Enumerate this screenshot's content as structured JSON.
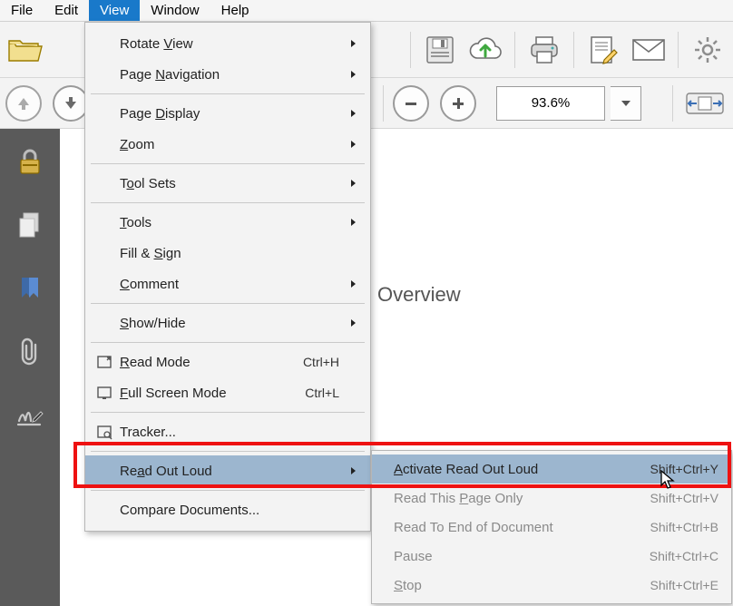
{
  "menubar": {
    "items": [
      "File",
      "Edit",
      "View",
      "Window",
      "Help"
    ],
    "selected": 2
  },
  "toolbar": {
    "open_label": "O"
  },
  "zoom": {
    "value": "93.6%"
  },
  "document": {
    "heading": "Overview"
  },
  "view_menu": {
    "items": [
      {
        "label": "Rotate View",
        "mn": "V",
        "sub": true
      },
      {
        "label": "Page Navigation",
        "mn": "N",
        "sub": true
      },
      {
        "sep": true
      },
      {
        "label": "Page Display",
        "mn": "D",
        "sub": true
      },
      {
        "label": "Zoom",
        "mn": "Z",
        "sub": true
      },
      {
        "sep": true
      },
      {
        "label": "Tool Sets",
        "mn": "o",
        "sub": true
      },
      {
        "sep": true
      },
      {
        "label": "Tools",
        "mn": "T",
        "sub": true
      },
      {
        "label": "Fill & Sign",
        "mn": "S"
      },
      {
        "label": "Comment",
        "mn": "C",
        "sub": true
      },
      {
        "sep": true
      },
      {
        "label": "Show/Hide",
        "mn": "S",
        "sub": true
      },
      {
        "sep": true
      },
      {
        "label": "Read Mode",
        "mn": "R",
        "shortcut": "Ctrl+H",
        "icon": "read-mode"
      },
      {
        "label": "Full Screen Mode",
        "mn": "F",
        "shortcut": "Ctrl+L",
        "icon": "fullscreen"
      },
      {
        "sep": true
      },
      {
        "label": "Tracker...",
        "mn": "K",
        "icon": "tracker"
      },
      {
        "sep": true
      },
      {
        "label": "Read Out Loud",
        "mn": "a",
        "sub": true,
        "hl": true
      },
      {
        "sep": true
      },
      {
        "label": "Compare Documents...",
        "mn": "M"
      }
    ]
  },
  "read_submenu": {
    "items": [
      {
        "label": "Activate Read Out Loud",
        "mn": "A",
        "shortcut": "Shift+Ctrl+Y",
        "hl": true
      },
      {
        "label": "Read This Page Only",
        "mn": "P",
        "shortcut": "Shift+Ctrl+V",
        "disabled": true
      },
      {
        "label": "Read To End of Document",
        "mn": "",
        "shortcut": "Shift+Ctrl+B",
        "disabled": true
      },
      {
        "label": "Pause",
        "mn": "",
        "shortcut": "Shift+Ctrl+C",
        "disabled": true
      },
      {
        "label": "Stop",
        "mn": "S",
        "shortcut": "Shift+Ctrl+E",
        "disabled": true
      }
    ]
  }
}
